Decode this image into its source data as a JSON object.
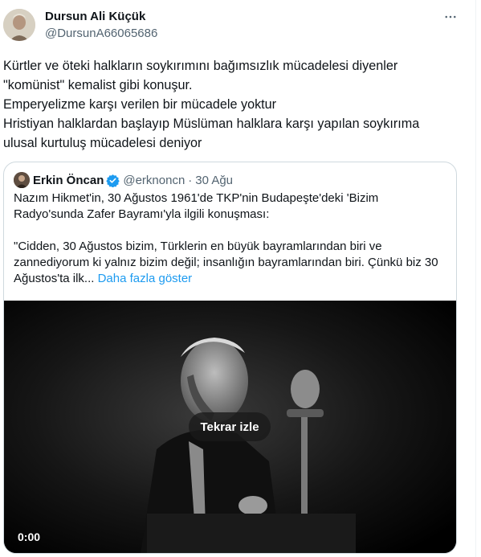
{
  "author": {
    "name": "Dursun Ali Küçük",
    "handle": "@DursunA66065686"
  },
  "tweet": {
    "lines": [
      "Kürtler ve öteki halkların soykırımını bağımsızlık mücadelesi diyenler",
      "\"komünist\" kemalist gibi konuşur.",
      "Emperyelizme karşı verilen bir mücadele yoktur",
      "Hristiyan halklardan başlayıp Müslüman halklara karşı yapılan soykırıma",
      "ulusal kurtuluş mücadelesi deniyor"
    ]
  },
  "quote": {
    "name": "Erkin Öncan",
    "handle": "@erknoncn",
    "separator": "·",
    "date": "30 Ağu",
    "lines": [
      "Nazım Hikmet'in, 30 Ağustos 1961'de TKP'nin Budapeşte'deki 'Bizim",
      "Radyo'sunda Zafer Bayramı'yla ilgili konuşması:",
      "",
      "\"Cidden, 30 Ağustos bizim, Türklerin en büyük bayramlarından biri ve",
      "zannediyorum ki yalnız bizim değil; insanlığın bayramlarından biri. Çünkü biz 30",
      "Ağustos'ta ilk..."
    ],
    "show_more": "Daha fazla göster"
  },
  "video": {
    "replay_label": "Tekrar izle",
    "time": "0:00"
  },
  "colors": {
    "link": "#1d9bf0",
    "verified": "#1d9bf0",
    "secondary_text": "#536471",
    "border": "#cfd9de"
  },
  "icons": {
    "more": "more-horizontal-icon",
    "verified": "verified-badge-icon"
  }
}
